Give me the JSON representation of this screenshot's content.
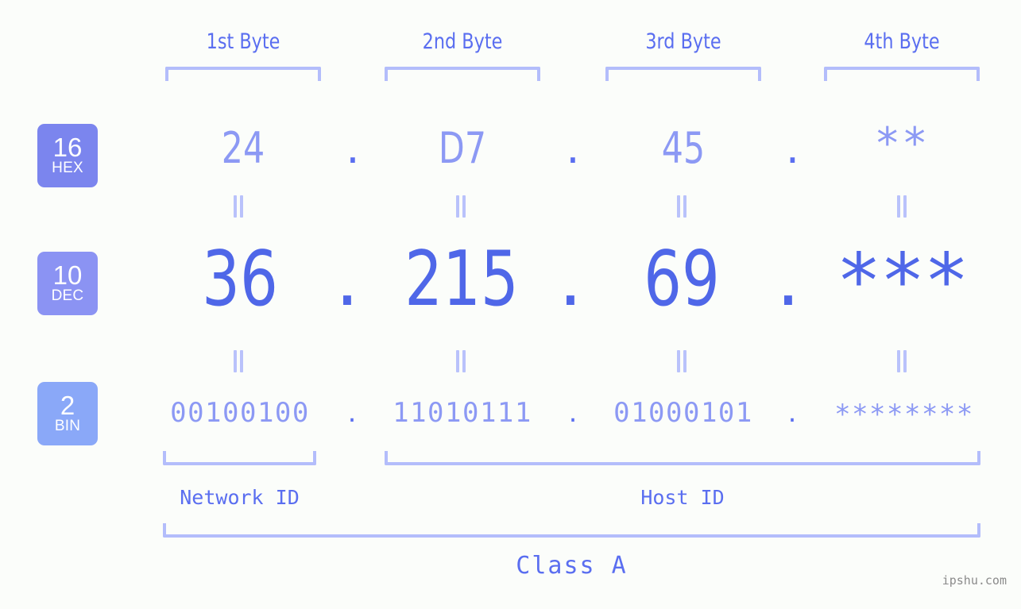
{
  "meta": {
    "background_color": "#fbfdfa",
    "accent_light": "#8c99f4",
    "accent_strong": "#4f67e8",
    "bracket_color": "#b3bdfb",
    "connector_color": "#b9c2fb"
  },
  "byte_headers": [
    {
      "label": "1st Byte"
    },
    {
      "label": "2nd Byte"
    },
    {
      "label": "3rd Byte"
    },
    {
      "label": "4th Byte"
    }
  ],
  "base_badges": [
    {
      "number": "16",
      "name": "HEX",
      "color": "#7b85ee"
    },
    {
      "number": "10",
      "name": "DEC",
      "color": "#8b93f3"
    },
    {
      "number": "2",
      "name": "BIN",
      "color": "#8aa8f8"
    }
  ],
  "rows": {
    "hex": {
      "base": "16",
      "label": "HEX",
      "values": [
        "24",
        "D7",
        "45",
        "**"
      ],
      "separator": "."
    },
    "dec": {
      "base": "10",
      "label": "DEC",
      "values": [
        "36",
        "215",
        "69",
        "***"
      ],
      "separator": "."
    },
    "bin": {
      "base": "2",
      "label": "BIN",
      "values": [
        "00100100",
        "11010111",
        "01000101",
        "********"
      ],
      "separator": "."
    }
  },
  "connectors": {
    "glyph": "||",
    "rows": 2,
    "per_row": 4
  },
  "segments": {
    "network_id": "Network ID",
    "host_id": "Host ID"
  },
  "class_label": "Class A",
  "watermark": "ipshu.com"
}
